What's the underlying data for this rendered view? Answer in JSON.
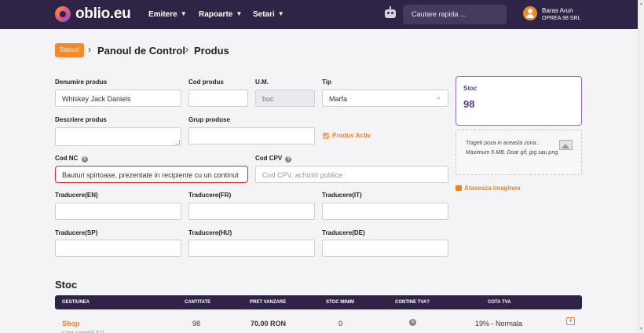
{
  "app": {
    "logo": "oblio.eu"
  },
  "nav": {
    "items": [
      "Emitere",
      "Rapoarte",
      "Setari"
    ]
  },
  "search": {
    "placeholder": "Cautare rapida ..."
  },
  "user": {
    "name": "Baras Arun",
    "company": "OPREA 98 SRL"
  },
  "breadcrumb": {
    "badge": "Stocuri",
    "level1": "Panoul de Control",
    "level2": "Produs"
  },
  "form": {
    "denumire": {
      "label": "Denumire produs",
      "value": "Whiskey Jack Daniels"
    },
    "cod": {
      "label": "Cod produs",
      "value": ""
    },
    "um": {
      "label": "U.M.",
      "value": "buc"
    },
    "tip": {
      "label": "Tip",
      "value": "Marfa"
    },
    "descriere": {
      "label": "Descriere produs",
      "value": ""
    },
    "grup": {
      "label": "Grup produse",
      "value": ""
    },
    "activ": {
      "label": "Produs Activ",
      "checked": true
    },
    "cod_nc": {
      "label": "Cod NC",
      "value": "Bauturi spirtoase, prezentate in recipiente cu un continut"
    },
    "cod_cpv": {
      "label": "Cod CPV",
      "placeholder": "Cod CPV, achizitii publice"
    },
    "traduceri": [
      {
        "label": "Traducere(EN)",
        "value": ""
      },
      {
        "label": "Traducere(FR)",
        "value": ""
      },
      {
        "label": "Traducere(IT)",
        "value": ""
      },
      {
        "label": "Traducere(SP)",
        "value": ""
      },
      {
        "label": "Traducere(HU)",
        "value": ""
      },
      {
        "label": "Traducere(DE)",
        "value": ""
      }
    ]
  },
  "stoc_card": {
    "title": "Stoc",
    "value": "98"
  },
  "dropzone": {
    "text": "Trageti poza in aceasta zona...",
    "sub": "Maximum 5 MB. Doar gif, jpg sau png."
  },
  "attach_label": "Ataseaza imaginea",
  "stoc_section": {
    "title": "Stoc",
    "columns": [
      "GESTIUNEA",
      "CANTITATE",
      "PRET VANZARE",
      "STOC MINIM",
      "CONTINE TVA?",
      "COTA TVA"
    ],
    "rows": [
      {
        "gestiune": "Shop",
        "cantitate": "98",
        "pret": "70.00 RON",
        "stoc_minim": "0",
        "contine_tva": "no",
        "cota_tva": "19% - Normala",
        "detail": "Cont contabil 371"
      }
    ]
  },
  "icons": {
    "nav": "chevron-down-icon",
    "help": "help-icon",
    "bot": "robot-icon",
    "image": "image-icon"
  },
  "colors": {
    "nav_bg": "#2f2346",
    "accent": "#f08a2c",
    "error": "#e0262b",
    "stoc_card": "#5b3a8a"
  }
}
